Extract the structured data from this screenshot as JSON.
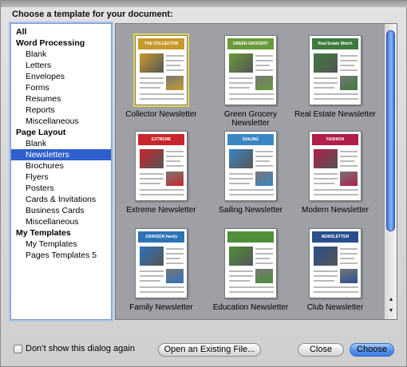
{
  "dialog": {
    "title": "Choose a template for your document:"
  },
  "sidebar": {
    "items": [
      {
        "label": "All",
        "kind": "heading"
      },
      {
        "label": "Word Processing",
        "kind": "heading"
      },
      {
        "label": "Blank",
        "kind": "child"
      },
      {
        "label": "Letters",
        "kind": "child"
      },
      {
        "label": "Envelopes",
        "kind": "child"
      },
      {
        "label": "Forms",
        "kind": "child"
      },
      {
        "label": "Resumes",
        "kind": "child"
      },
      {
        "label": "Reports",
        "kind": "child"
      },
      {
        "label": "Miscellaneous",
        "kind": "child"
      },
      {
        "label": "Page Layout",
        "kind": "heading"
      },
      {
        "label": "Blank",
        "kind": "child"
      },
      {
        "label": "Newsletters",
        "kind": "child",
        "selected": true
      },
      {
        "label": "Brochures",
        "kind": "child"
      },
      {
        "label": "Flyers",
        "kind": "child"
      },
      {
        "label": "Posters",
        "kind": "child"
      },
      {
        "label": "Cards & Invitations",
        "kind": "child"
      },
      {
        "label": "Business Cards",
        "kind": "child"
      },
      {
        "label": "Miscellaneous",
        "kind": "child"
      },
      {
        "label": "My Templates",
        "kind": "heading"
      },
      {
        "label": "My Templates",
        "kind": "child"
      },
      {
        "label": "Pages Templates 5",
        "kind": "child"
      }
    ]
  },
  "templates": [
    {
      "label": "Collector Newsletter",
      "masthead": "THE COLLECTOR",
      "accent": "#c89a2c",
      "selected": true
    },
    {
      "label": "Green Grocery Newsletter",
      "masthead": "GREEN GROCERY",
      "accent": "#6a9a3a"
    },
    {
      "label": "Real Estate Newsletter",
      "masthead": "Real Estate Watch",
      "accent": "#3f7a3f"
    },
    {
      "label": "Extreme Newsletter",
      "masthead": "EXTREME",
      "accent": "#c8262c"
    },
    {
      "label": "Sailing Newsletter",
      "masthead": "SAILING",
      "accent": "#3a86c4"
    },
    {
      "label": "Modern Newsletter",
      "masthead": "FASHION",
      "accent": "#b01e4a"
    },
    {
      "label": "Family Newsletter",
      "masthead": "JOHNSON family",
      "accent": "#2f73b8"
    },
    {
      "label": "Education Newsletter",
      "masthead": "",
      "accent": "#4f8f3a"
    },
    {
      "label": "Club Newsletter",
      "masthead": "NEWSLETTER",
      "accent": "#2a4f8c"
    }
  ],
  "footer": {
    "dont_show_label": "Don’t show this dialog again",
    "open_existing_label": "Open an Existing File...",
    "close_label": "Close",
    "choose_label": "Choose"
  },
  "colors": {
    "selection": "#2f5fcd",
    "primary_button": "#3b7ae0"
  }
}
